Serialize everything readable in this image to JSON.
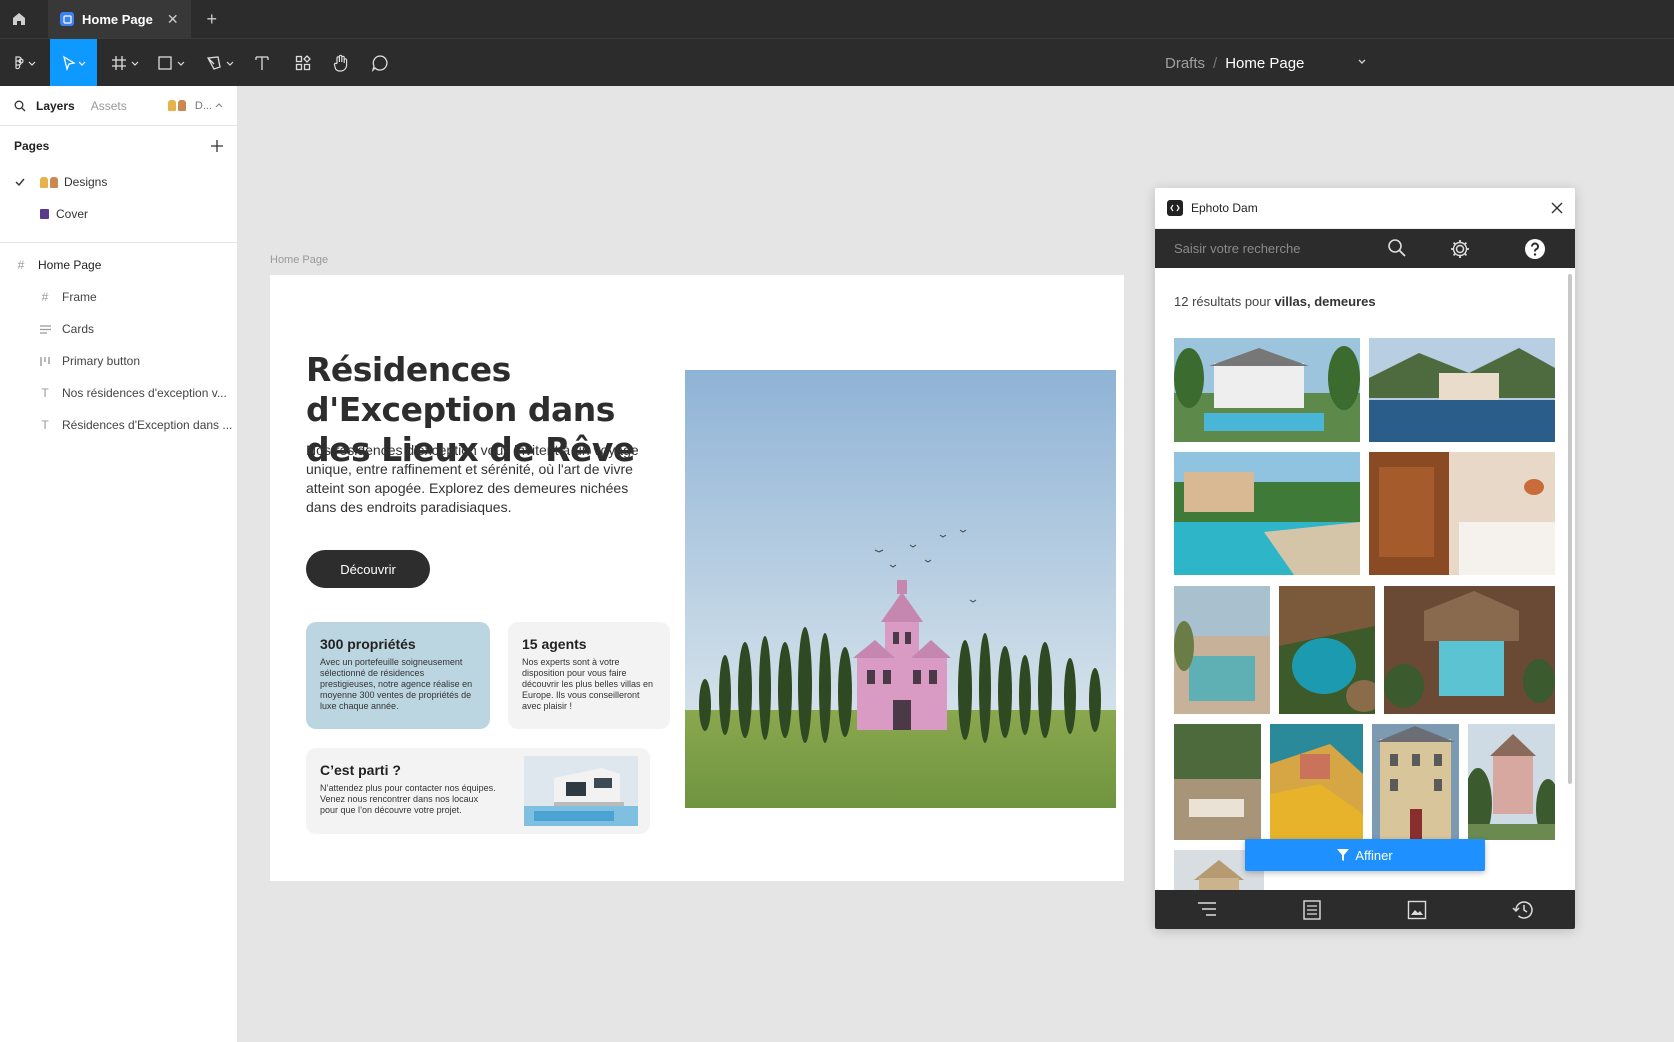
{
  "tabbar": {
    "tab_title": "Home Page",
    "close_glyph": "✕",
    "add_glyph": "+"
  },
  "toolbar": {
    "tools": [
      "figma-menu-icon",
      "move-tool-icon",
      "frame-tool-icon",
      "shape-tool-icon",
      "pen-tool-icon",
      "text-tool-icon",
      "resources-icon",
      "hand-tool-icon",
      "comment-icon"
    ],
    "breadcrumb_drafts": "Drafts",
    "breadcrumb_sep": "/",
    "breadcrumb_page": "Home Page",
    "accent": "#0d99ff"
  },
  "left_panel": {
    "tab_layers": "Layers",
    "tab_assets": "Assets",
    "page_selector": "D...",
    "pages_heading": "Pages",
    "pages": [
      {
        "label": "Designs",
        "selected": true
      },
      {
        "label": "Cover",
        "selected": false
      }
    ],
    "layers": [
      {
        "label": "Home Page",
        "icon": "frame-icon"
      },
      {
        "label": "Frame",
        "icon": "frame-icon"
      },
      {
        "label": "Cards",
        "icon": "auto-layout-icon"
      },
      {
        "label": "Primary button",
        "icon": "component-layout-icon"
      },
      {
        "label": "Nos résidences d'exception v...",
        "icon": "text-layer-icon"
      },
      {
        "label": "Résidences d'Exception dans ...",
        "icon": "text-layer-icon"
      }
    ]
  },
  "canvas": {
    "frame_label": "Home Page",
    "hero_title": "Résidences d'Exception dans des Lieux de Rêve",
    "hero_text": "Nos résidences d'exception vous invitent à un voyage unique, entre raffinement et sérénité, où l'art de vivre atteint son apogée. Explorez des demeures nichées dans des endroits paradisiaques.",
    "cta_label": "Découvrir",
    "card_a": {
      "title": "300 propriétés",
      "text": "Avec un portefeuille soigneusement sélectionné de résidences prestigieuses, notre agence réalise en moyenne 300 ventes de propriétés de luxe chaque année.",
      "bg": "#bcd6e1"
    },
    "card_b": {
      "title": "15 agents",
      "text": "Nos experts sont à votre disposition pour vous faire découvrir les plus belles villas en Europe. Ils vous conseilleront avec plaisir !"
    },
    "card_c": {
      "title": "C’est parti ?",
      "text": "N’attendez plus pour contacter nos équipes. Venez nous rencontrer dans nos locaux pour que l’on découvre votre projet."
    }
  },
  "plugin": {
    "title": "Ephoto Dam",
    "search_placeholder": "Saisir votre recherche",
    "results_prefix": "12 résultats pour ",
    "results_query": "villas, demeures",
    "refine_label": "Affiner",
    "accent": "#1e90ff",
    "footer_icons": [
      "menu-lines-icon",
      "document-icon",
      "image-icon",
      "history-icon"
    ]
  }
}
